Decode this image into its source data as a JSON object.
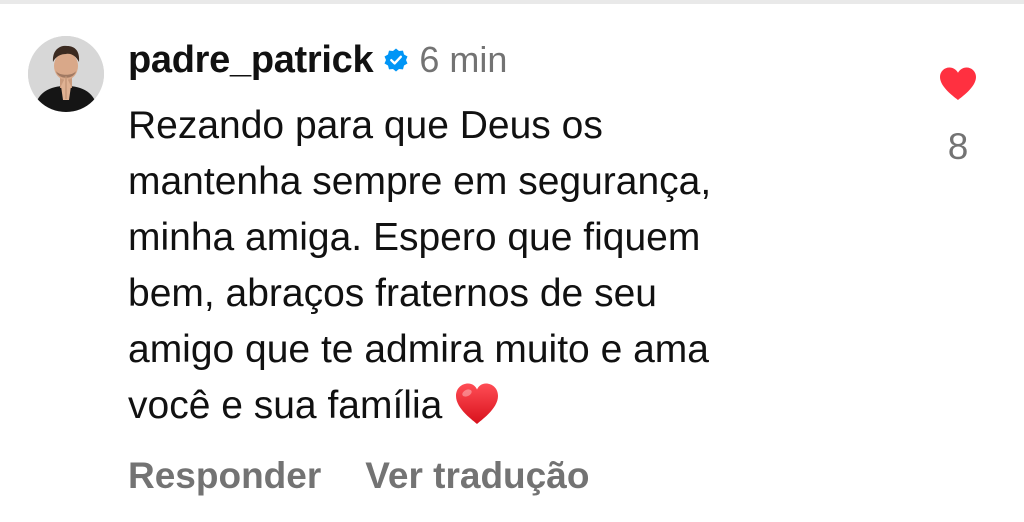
{
  "comment": {
    "username": "padre_patrick",
    "time": "6 min",
    "verified_icon": "verified-badge-icon",
    "text_lines": [
      "Rezando para que Deus os",
      "mantenha sempre em segurança,",
      "minha amiga. Espero que fiquem",
      "bem, abraços fraternos de seu",
      "amigo que te admira muito e ama",
      "você e sua família"
    ],
    "trailing_emoji": "red-heart-emoji",
    "actions": {
      "reply": "Responder",
      "translate": "Ver tradução"
    },
    "like": {
      "icon": "heart-filled-icon",
      "count": "8",
      "color": "#ff3040"
    }
  },
  "colors": {
    "text": "#111111",
    "secondary": "#737373",
    "verified": "#0095f6",
    "like": "#ff3040"
  }
}
